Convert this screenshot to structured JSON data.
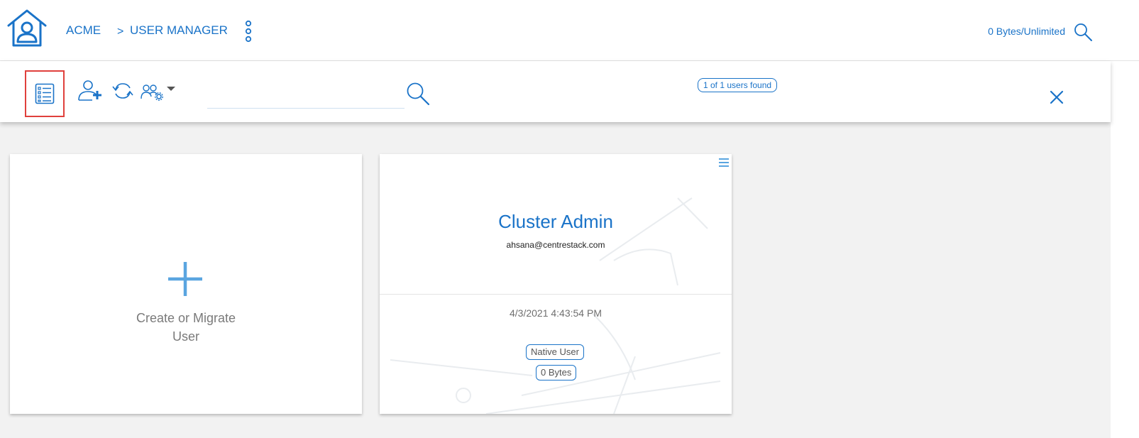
{
  "header": {
    "breadcrumb_root": "ACME",
    "breadcrumb_separator": ">",
    "breadcrumb_current": "USER MANAGER",
    "quota": "0 Bytes/Unlimited"
  },
  "toolbar": {
    "search_placeholder": "",
    "search_value": "",
    "results_count": "1 of 1 users found"
  },
  "cards": {
    "create": {
      "label_line1": "Create or Migrate",
      "label_line2": "User"
    },
    "user": {
      "name": "Cluster Admin",
      "email": "ahsana@centrestack.com",
      "date": "4/3/2021 4:43:54 PM",
      "type": "Native User",
      "size": "0 Bytes"
    }
  },
  "icons": {
    "home": "home-icon",
    "more": "vertical-ellipsis-icon",
    "search": "search-icon",
    "list_view": "list-view-icon",
    "add_user": "add-user-icon",
    "sync": "sync-icon",
    "group_settings": "group-settings-icon",
    "dropdown": "caret-down-icon",
    "close": "close-icon",
    "plus": "plus-icon",
    "card_menu": "hamburger-menu-icon"
  },
  "colors": {
    "accent": "#1a73c8",
    "highlight": "#e0403c",
    "background": "#f2f2f2"
  }
}
